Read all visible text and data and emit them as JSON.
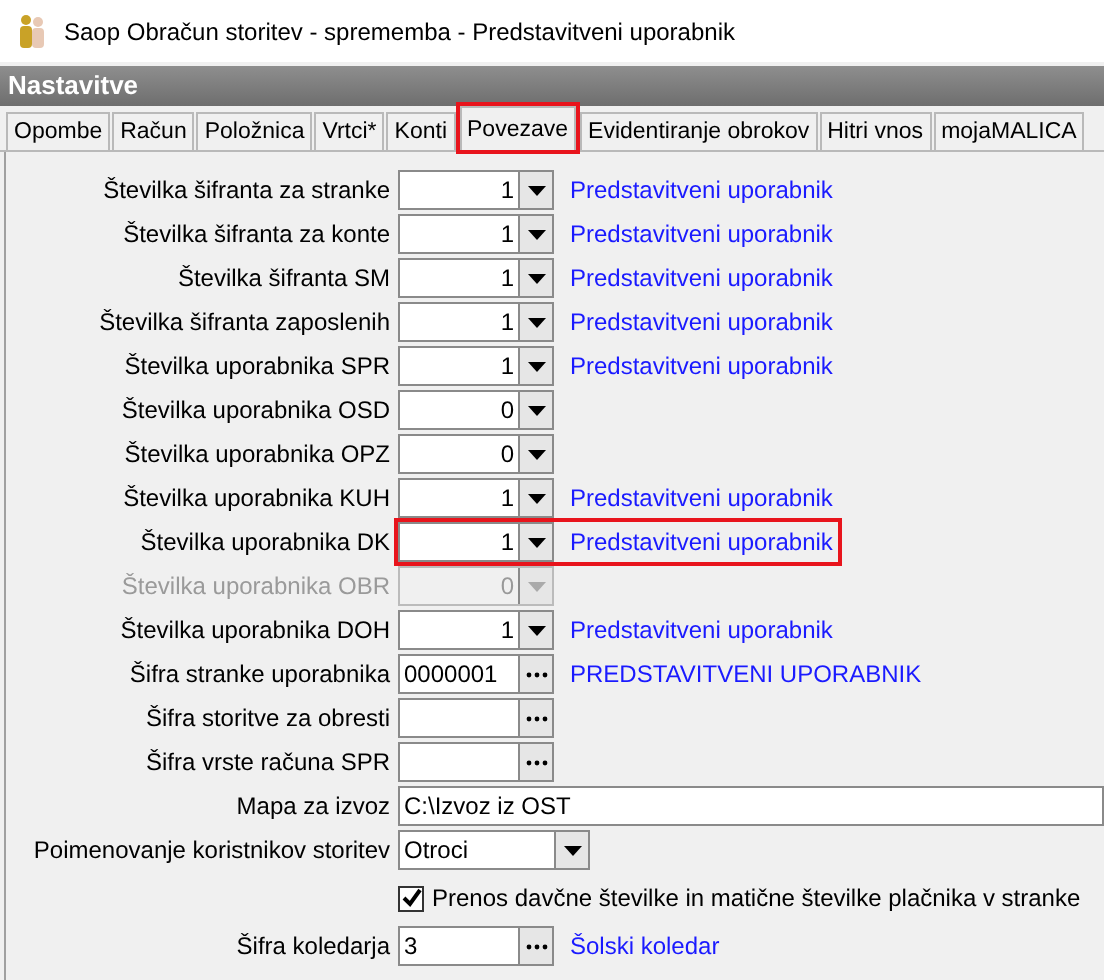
{
  "window": {
    "title": "Saop Obračun storitev - sprememba - Predstavitveni uporabnik"
  },
  "header": "Nastavitve",
  "tabs": [
    {
      "label": "Opombe",
      "selected": false,
      "highlighted": false
    },
    {
      "label": "Račun",
      "selected": false,
      "highlighted": false
    },
    {
      "label": "Položnica",
      "selected": false,
      "highlighted": false
    },
    {
      "label": "Vrtci*",
      "selected": false,
      "highlighted": false
    },
    {
      "label": "Konti",
      "selected": false,
      "highlighted": false
    },
    {
      "label": "Povezave",
      "selected": true,
      "highlighted": true
    },
    {
      "label": "Evidentiranje obrokov",
      "selected": false,
      "highlighted": false
    },
    {
      "label": "Hitri vnos",
      "selected": false,
      "highlighted": false
    },
    {
      "label": "mojaMALICA",
      "selected": false,
      "highlighted": false
    }
  ],
  "rows": [
    {
      "kind": "combo",
      "label": "Številka šifranta za stranke",
      "value": "1",
      "link": "Predstavitveni uporabnik",
      "disabled": false,
      "highlighted": false
    },
    {
      "kind": "combo",
      "label": "Številka šifranta za konte",
      "value": "1",
      "link": "Predstavitveni uporabnik",
      "disabled": false,
      "highlighted": false
    },
    {
      "kind": "combo",
      "label": "Številka šifranta SM",
      "value": "1",
      "link": "Predstavitveni uporabnik",
      "disabled": false,
      "highlighted": false
    },
    {
      "kind": "combo",
      "label": "Številka šifranta zaposlenih",
      "value": "1",
      "link": "Predstavitveni uporabnik",
      "disabled": false,
      "highlighted": false
    },
    {
      "kind": "combo",
      "label": "Številka uporabnika SPR",
      "value": "1",
      "link": "Predstavitveni uporabnik",
      "disabled": false,
      "highlighted": false
    },
    {
      "kind": "combo",
      "label": "Številka uporabnika OSD",
      "value": "0",
      "disabled": false,
      "highlighted": false
    },
    {
      "kind": "combo",
      "label": "Številka uporabnika OPZ",
      "value": "0",
      "disabled": false,
      "highlighted": false
    },
    {
      "kind": "combo",
      "label": "Številka uporabnika KUH",
      "value": "1",
      "link": "Predstavitveni uporabnik",
      "disabled": false,
      "highlighted": false
    },
    {
      "kind": "combo",
      "label": "Številka uporabnika DK",
      "value": "1",
      "link": "Predstavitveni uporabnik",
      "disabled": false,
      "highlighted": true
    },
    {
      "kind": "combo",
      "label": "Številka uporabnika OBR",
      "value": "0",
      "disabled": true,
      "highlighted": false
    },
    {
      "kind": "combo",
      "label": "Številka uporabnika DOH",
      "value": "1",
      "link": "Predstavitveni uporabnik",
      "disabled": false,
      "highlighted": false
    },
    {
      "kind": "lookup",
      "label": "Šifra stranke uporabnika",
      "value": "0000001",
      "link": "PREDSTAVITVENI UPORABNIK"
    },
    {
      "kind": "lookup",
      "label": "Šifra storitve za obresti"
    },
    {
      "kind": "lookup",
      "label": "Šifra vrste računa SPR"
    },
    {
      "kind": "text",
      "label": "Mapa za izvoz",
      "value": "C:\\Izvoz iz OST"
    },
    {
      "kind": "select",
      "label": "Poimenovanje koristnikov storitev",
      "value": "Otroci"
    },
    {
      "kind": "checkbox",
      "text": "Prenos davčne številke in matične številke plačnika v stranke",
      "checked": true
    },
    {
      "kind": "lookup",
      "label": "Šifra koledarja",
      "value": "3",
      "link": "Šolski koledar"
    }
  ]
}
